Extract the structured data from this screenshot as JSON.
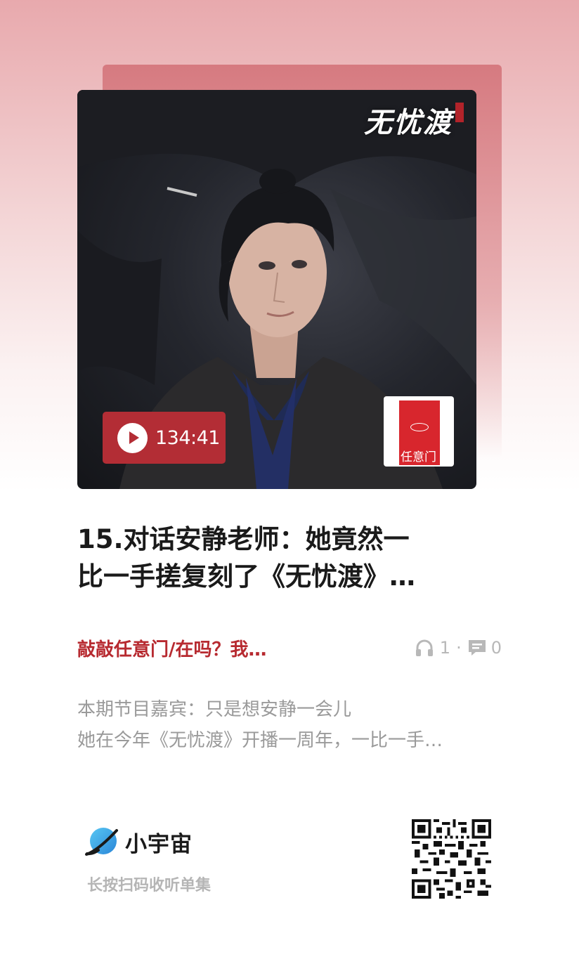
{
  "cover": {
    "show_logo": "无忧渡",
    "duration": "134:41",
    "podcast_thumb_title": "任意门"
  },
  "episode": {
    "title_line1": "15.对话安静老师：她竟然一",
    "title_line2": "比一手搓复刻了《无忧渡》…"
  },
  "meta": {
    "podcast_name": "敲敲任意门/在吗？我…",
    "listen_count": "1",
    "separator": "·",
    "comment_count": "0"
  },
  "description": {
    "line1": "本期节目嘉宾：只是想安静一会儿",
    "line2": "她在今年《无忧渡》开播一周年，一比一手…"
  },
  "footer": {
    "brand_name": "小宇宙",
    "scan_hint": "长按扫码收听单集"
  },
  "colors": {
    "accent_red": "#b32d35",
    "podcast_name_red": "#b72a30",
    "brand_blue": "#3aa8e8"
  },
  "icons": [
    "play-icon",
    "headphone-icon",
    "comment-icon",
    "brand-planet-icon",
    "qr-code"
  ]
}
